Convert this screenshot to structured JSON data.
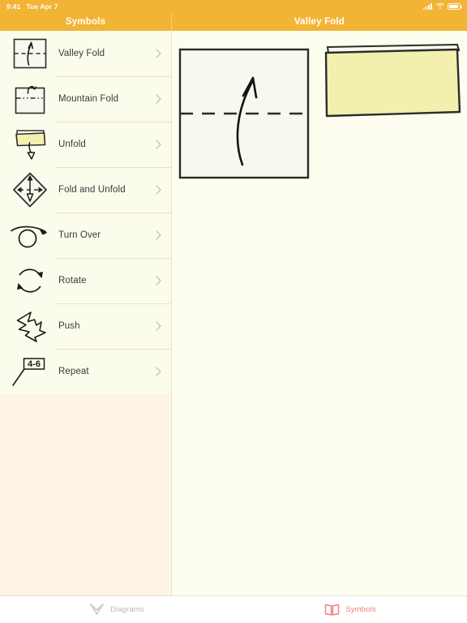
{
  "status_bar": {
    "time": "9:41",
    "date": "Tue Apr 7",
    "signal_icon": "cellular-signal-icon",
    "wifi_icon": "wifi-icon",
    "battery_icon": "battery-icon"
  },
  "nav": {
    "left_title": "Symbols",
    "right_title": "Valley Fold",
    "accent_color": "#F2B434"
  },
  "sidebar": {
    "background_color": "#FDF4E6",
    "list_background_color": "#FCFCEC",
    "items": [
      {
        "label": "Valley Fold",
        "icon": "valley-fold-icon",
        "chevron": "chevron-right-icon"
      },
      {
        "label": "Mountain Fold",
        "icon": "mountain-fold-icon",
        "chevron": "chevron-right-icon"
      },
      {
        "label": "Unfold",
        "icon": "unfold-icon",
        "chevron": "chevron-right-icon"
      },
      {
        "label": "Fold and Unfold",
        "icon": "fold-and-unfold-icon",
        "chevron": "chevron-right-icon"
      },
      {
        "label": "Turn Over",
        "icon": "turn-over-icon",
        "chevron": "chevron-right-icon"
      },
      {
        "label": "Rotate",
        "icon": "rotate-icon",
        "chevron": "chevron-right-icon"
      },
      {
        "label": "Push",
        "icon": "push-icon",
        "chevron": "chevron-right-icon"
      },
      {
        "label": "Repeat",
        "icon": "repeat-icon",
        "chevron": "chevron-right-icon",
        "icon_text": "4-6"
      }
    ]
  },
  "detail": {
    "background_color": "#FEFEF0",
    "diagram": {
      "name": "valley-fold-diagram",
      "paper_fill": "#F8F8EE",
      "folded_fill": "#F2EFAF",
      "stroke_color": "#222222",
      "step1_label": "square sheet with horizontal valley crease and upward curved fold arrow",
      "step2_label": "resulting sheet folded in half upward"
    }
  },
  "tab_bar": {
    "background_color": "#FFFFFF",
    "active_color": "#F08080",
    "inactive_color": "#B9B9B9",
    "tabs": [
      {
        "label": "Diagrams",
        "icon": "diagrams-icon",
        "active": false
      },
      {
        "label": "Symbols",
        "icon": "symbols-icon",
        "active": true
      }
    ]
  }
}
